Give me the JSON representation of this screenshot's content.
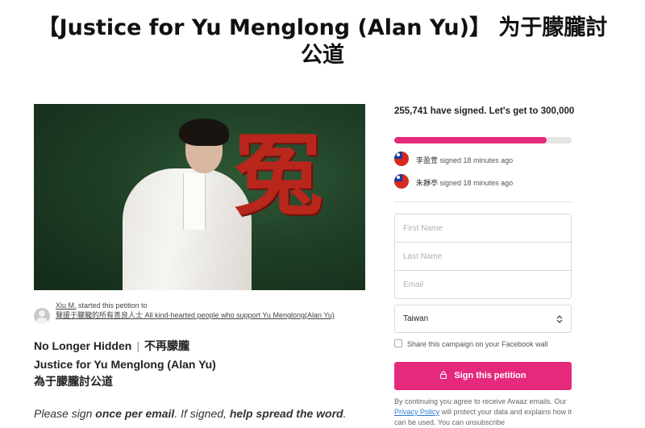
{
  "page": {
    "title_line1": "【Justice for Yu Menglong (Alan Yu)】 为于朦朧討",
    "title_line2": "公道"
  },
  "hero": {
    "calligraphy": "冤"
  },
  "starter": {
    "name": "Xiu M.",
    "started_text": "started this petition to",
    "recipients": "聲援于朦朧的所有善良人士   All kind-hearted people who support Yu Menglong(Alan Yu)"
  },
  "petition": {
    "title_en": "No Longer Hidden",
    "separator": "|",
    "title_zh": "不再朦朧",
    "subtitle_en": "Justice for Yu Menglong (Alan Yu)",
    "subtitle_zh": "為于朦朧討公道",
    "cta_prefix": "Please sign ",
    "cta_bold1": "once per email",
    "cta_middle": ". If signed, ",
    "cta_bold2": "help spread the word",
    "cta_suffix": "."
  },
  "signatures": {
    "count_text": "255,741 have signed. Let's get to 300,000",
    "signed": 255741,
    "goal": 300000,
    "progress_fraction": 0.86,
    "accent_color": "#e5297d",
    "recent": [
      {
        "name": "李盈萱",
        "action": "signed 18 minutes ago",
        "flag": "taiwan-flag-icon"
      },
      {
        "name": "朱靜亭",
        "action": "signed 18 minutes ago",
        "flag": "taiwan-flag-icon"
      }
    ]
  },
  "form": {
    "first_name_placeholder": "First Name",
    "last_name_placeholder": "Last Name",
    "email_placeholder": "Email",
    "country_value": "Taiwan",
    "facebook_share_label": "Share this campaign on your Facebook wall",
    "sign_button_label": "Sign this petition",
    "legal_prefix": "By continuing you agree to receive Avaaz emails. Our ",
    "privacy_link": "Privacy Policy",
    "legal_suffix": " will protect your data and explains how it can be used. You can unsubscribe"
  }
}
